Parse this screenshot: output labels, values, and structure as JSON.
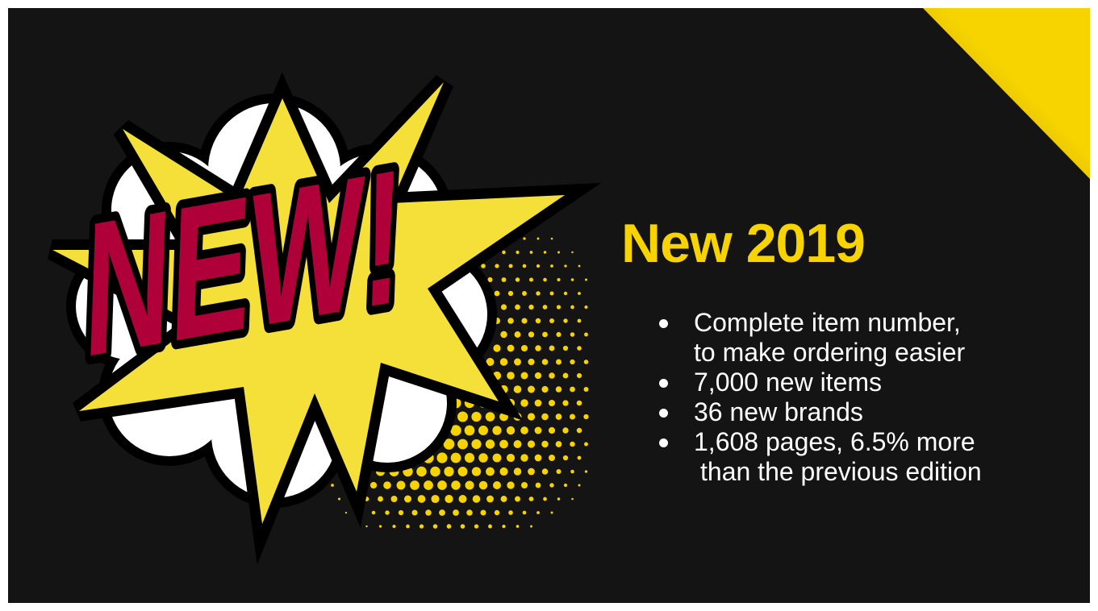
{
  "slide": {
    "title": "New 2019",
    "bullets": [
      {
        "line1": "Complete item number,",
        "line2": "to make ordering easier"
      },
      {
        "line1": "7,000 new items"
      },
      {
        "line1": "36 new brands"
      },
      {
        "line1": "1,608 pages, 6.5% more",
        "line2": "than the previous edition"
      }
    ],
    "graphic": {
      "word": "NEW!",
      "colors": {
        "burst": "#f5e03a",
        "word": "#b0003a",
        "cloud": "#ffffff",
        "outline": "#000000",
        "dots": "#f7d400",
        "background": "#141414",
        "accent_corner": "#f7d400"
      }
    }
  }
}
